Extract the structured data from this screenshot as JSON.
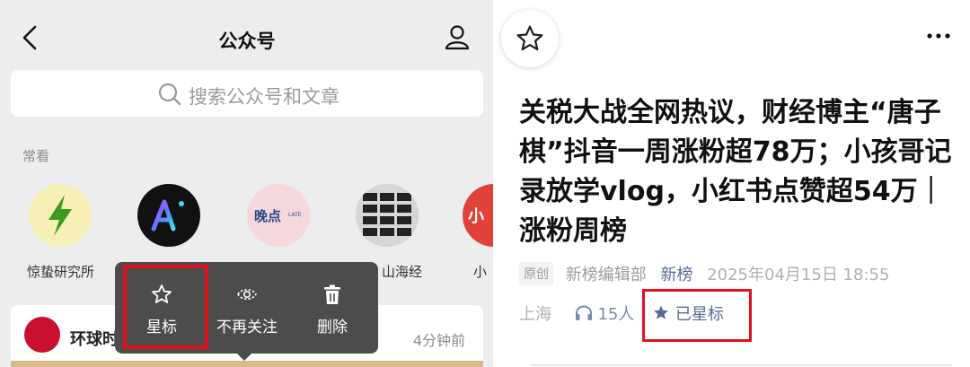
{
  "left": {
    "header": {
      "title": "公众号"
    },
    "search": {
      "placeholder": "搜索公众号和文章"
    },
    "section_label": "常看",
    "accounts": [
      {
        "name": "惊蛰研究所",
        "icon": "lightning-bolt-avatar"
      },
      {
        "name": "",
        "icon": "ai-logo-avatar"
      },
      {
        "name": "",
        "icon": "wandian-logo-avatar"
      },
      {
        "name": "山海经",
        "icon": "horse-grid-avatar"
      },
      {
        "name": "小",
        "icon": "red-partial-avatar"
      }
    ],
    "card": {
      "name": "环球时",
      "time": "4分钟前"
    },
    "context_menu": [
      {
        "label": "星标",
        "icon": "star-icon"
      },
      {
        "label": "不再关注",
        "icon": "eye-off-icon"
      },
      {
        "label": "删除",
        "icon": "trash-icon"
      }
    ]
  },
  "right": {
    "headline": "关税大战全网热议，财经博主“唐子棋”抖音一周涨粉超78万；小孩哥记录放学vlog，小红书点赞超54万｜涨粉周榜",
    "meta": {
      "badge": "原创",
      "author": "新榜编辑部",
      "account": "新榜",
      "date": "2025年04月15日 18:55",
      "location": "上海",
      "listens": "15人",
      "starred": "已星标"
    }
  },
  "colors": {
    "highlight": "#e0101f",
    "link": "#576b95",
    "menu_bg": "#4c4c4c"
  }
}
